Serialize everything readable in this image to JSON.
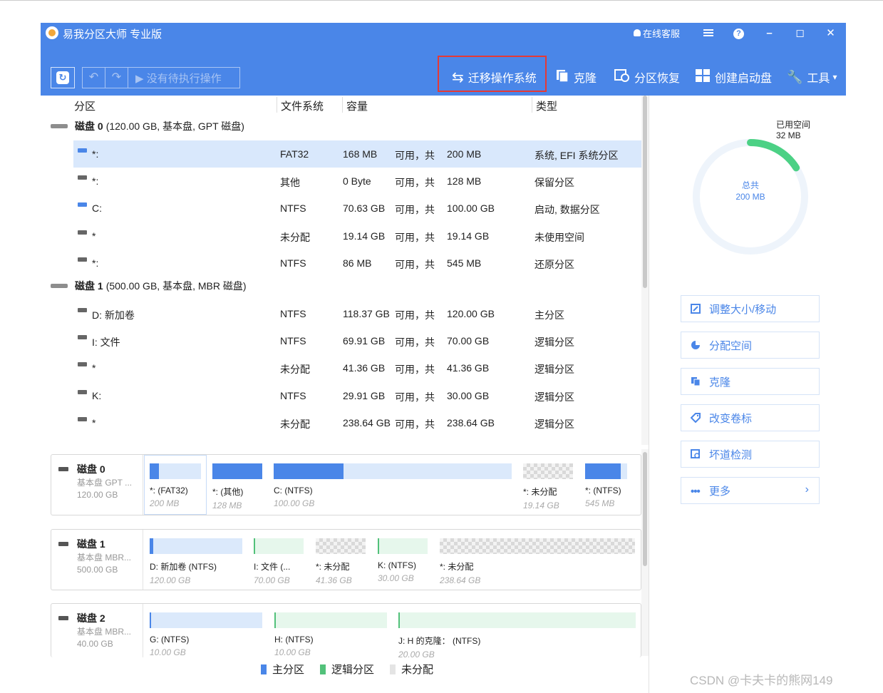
{
  "app": {
    "title": "易我分区大师 专业版",
    "online_service": "在线客服",
    "menu_icon": "hamburger-icon",
    "help_icon": "question-icon",
    "minimize": "–",
    "maximize": "◻",
    "close": "✕"
  },
  "toolbar": {
    "pending_ops": "没有待执行操作",
    "migrate_os": "迁移操作系统",
    "clone": "克隆",
    "recover": "分区恢复",
    "boot_disk": "创建启动盘",
    "tools": "工具"
  },
  "columns": {
    "partition": "分区",
    "filesystem": "文件系统",
    "capacity": "容量",
    "type": "类型"
  },
  "disks": [
    {
      "name": "磁盘 0",
      "desc": "(120.00 GB, 基本盘, GPT 磁盘)",
      "partitions": [
        {
          "label": "*:",
          "fs": "FAT32",
          "free": "168 MB",
          "avail": "可用，共",
          "total": "200 MB",
          "type": "系统, EFI 系统分区",
          "icon": "system"
        },
        {
          "label": "*:",
          "fs": "其他",
          "free": "0 Byte",
          "avail": "可用，共",
          "total": "128 MB",
          "type": "保留分区",
          "icon": "drive"
        },
        {
          "label": "C:",
          "fs": "NTFS",
          "free": "70.63 GB",
          "avail": "可用，共",
          "total": "100.00 GB",
          "type": "启动, 数据分区",
          "icon": "system"
        },
        {
          "label": "*",
          "fs": "未分配",
          "free": "19.14 GB",
          "avail": "可用，共",
          "total": "19.14 GB",
          "type": "未使用空间",
          "icon": "drive"
        },
        {
          "label": "*:",
          "fs": "NTFS",
          "free": "86 MB",
          "avail": "可用，共",
          "total": "545 MB",
          "type": "还原分区",
          "icon": "drive"
        }
      ]
    },
    {
      "name": "磁盘 1",
      "desc": "(500.00 GB, 基本盘, MBR 磁盘)",
      "partitions": [
        {
          "label": "D: 新加卷",
          "fs": "NTFS",
          "free": "118.37 GB",
          "avail": "可用，共",
          "total": "120.00 GB",
          "type": "主分区",
          "icon": "drive"
        },
        {
          "label": "I: 文件",
          "fs": "NTFS",
          "free": "69.91 GB",
          "avail": "可用，共",
          "total": "70.00 GB",
          "type": "逻辑分区",
          "icon": "drive"
        },
        {
          "label": "*",
          "fs": "未分配",
          "free": "41.36 GB",
          "avail": "可用，共",
          "total": "41.36 GB",
          "type": "逻辑分区",
          "icon": "drive"
        },
        {
          "label": "K:",
          "fs": "NTFS",
          "free": "29.91 GB",
          "avail": "可用，共",
          "total": "30.00 GB",
          "type": "逻辑分区",
          "icon": "drive"
        },
        {
          "label": "*",
          "fs": "未分配",
          "free": "238.64 GB",
          "avail": "可用，共",
          "total": "238.64 GB",
          "type": "逻辑分区",
          "icon": "drive"
        }
      ]
    }
  ],
  "maps": [
    {
      "name": "磁盘 0",
      "type": "基本盘 GPT ...",
      "size": "120.00 GB",
      "segments": [
        {
          "label": "*: (FAT32)",
          "size": "200 MB",
          "kind": "primary",
          "used": 0.16
        },
        {
          "label": "*: (其他)",
          "size": "128 MB",
          "kind": "primary",
          "used": 1.0
        },
        {
          "label": "C: (NTFS)",
          "size": "100.00 GB",
          "kind": "primary",
          "used": 0.29
        },
        {
          "label": "*: 未分配",
          "size": "19.14 GB",
          "kind": "unalloc",
          "used": 0
        },
        {
          "label": "*: (NTFS)",
          "size": "545 MB",
          "kind": "primary",
          "used": 0.85
        }
      ]
    },
    {
      "name": "磁盘 1",
      "type": "基本盘 MBR...",
      "size": "500.00 GB",
      "segments": [
        {
          "label": "D: 新加卷 (NTFS)",
          "size": "120.00 GB",
          "kind": "primary",
          "used": 0.02
        },
        {
          "label": "I: 文件 (...",
          "size": "70.00 GB",
          "kind": "logical",
          "used": 0
        },
        {
          "label": "*: 未分配",
          "size": "41.36 GB",
          "kind": "unalloc",
          "used": 0
        },
        {
          "label": "K: (NTFS)",
          "size": "30.00 GB",
          "kind": "logical",
          "used": 0
        },
        {
          "label": "*: 未分配",
          "size": "238.64 GB",
          "kind": "unalloc",
          "used": 0
        }
      ]
    },
    {
      "name": "磁盘 2",
      "type": "基本盘 MBR...",
      "size": "40.00 GB",
      "segments": [
        {
          "label": "G: (NTFS)",
          "size": "10.00 GB",
          "kind": "primary",
          "used": 0
        },
        {
          "label": "H: (NTFS)",
          "size": "10.00 GB",
          "kind": "logical",
          "used": 0
        },
        {
          "label": "J: H 的克隆： (NTFS)",
          "size": "20.00 GB",
          "kind": "logical",
          "used": 0
        }
      ]
    }
  ],
  "legend": {
    "primary": "主分区",
    "logical": "逻辑分区",
    "unalloc": "未分配",
    "primary_color": "#4a86e8",
    "logical_color": "#52c17a"
  },
  "usage": {
    "used_label": "已用空间",
    "used_value": "32 MB",
    "total_label": "总共",
    "total_value": "200 MB",
    "used_fraction": 0.16
  },
  "actions": {
    "resize": "调整大小/移动",
    "allocate": "分配空间",
    "clone": "克隆",
    "label": "改变卷标",
    "badsector": "坏道检测",
    "more": "更多"
  },
  "watermark": "CSDN @卡夫卡的熊网149"
}
